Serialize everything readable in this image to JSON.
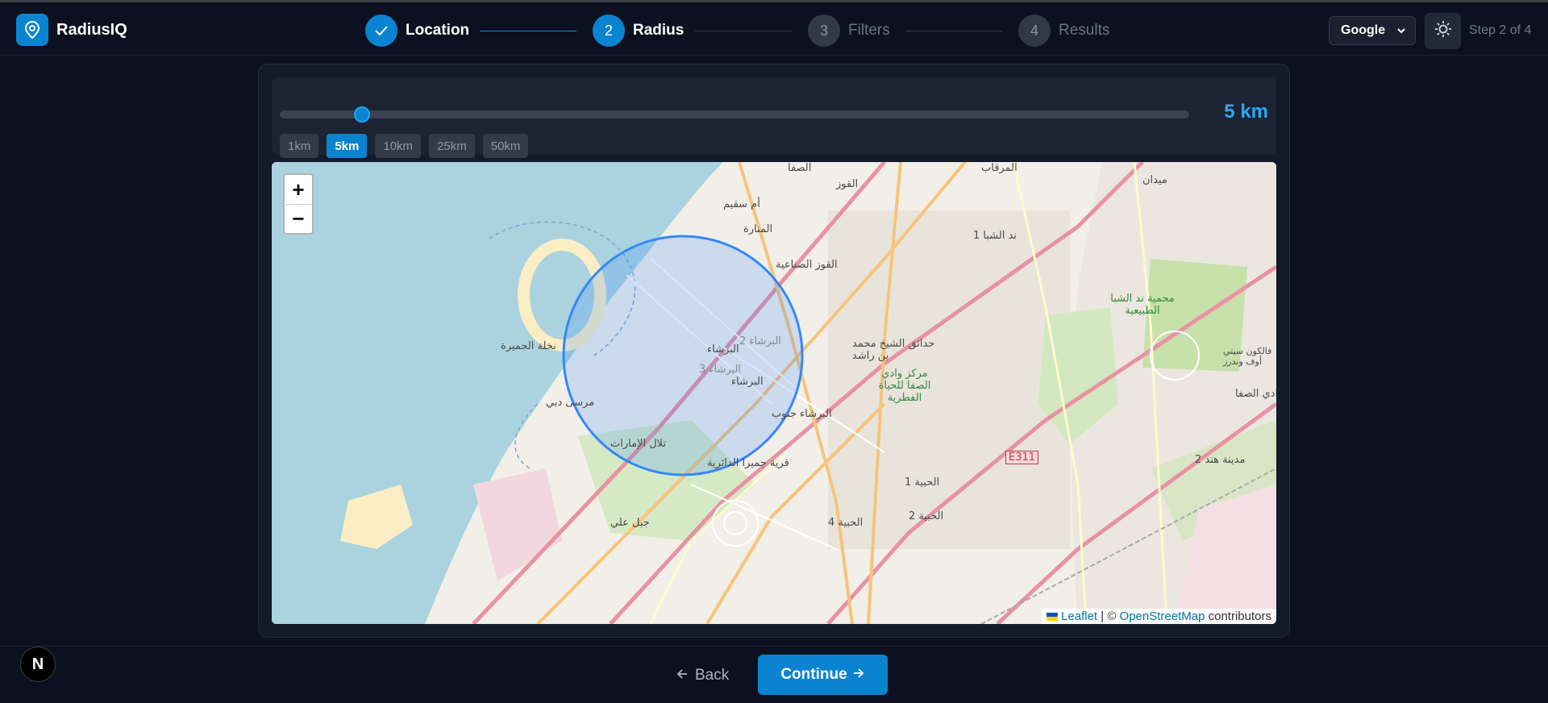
{
  "app": {
    "name": "RadiusIQ"
  },
  "steps": [
    {
      "number": "1",
      "label": "Location",
      "state": "done"
    },
    {
      "number": "2",
      "label": "Radius",
      "state": "active"
    },
    {
      "number": "3",
      "label": "Filters",
      "state": "todo"
    },
    {
      "number": "4",
      "label": "Results",
      "state": "todo"
    }
  ],
  "header": {
    "provider_select": {
      "value": "Google"
    },
    "step_counter": "Step 2 of 4"
  },
  "radius": {
    "value_label": "5 km",
    "slider_fraction": 0.09,
    "presets": [
      "1km",
      "5km",
      "10km",
      "25km",
      "50km"
    ],
    "selected_preset": "5km"
  },
  "map": {
    "zoom_in": "+",
    "zoom_out": "−",
    "attribution": {
      "leaflet": "Leaflet",
      "separator": " | © ",
      "osm": "OpenStreetMap",
      "suffix": " contributors"
    },
    "labels": {
      "palm": "نخلة الجميرة",
      "marsa": "مرسى دبي",
      "barsha": "البرشاء",
      "barsha2": "البرشاء 2",
      "barsha3": "البرشاء 3",
      "barsha_south": "البرشاء جنوب",
      "emirates_hills": "تلال الإمارات",
      "jvc": "قرية جميرا الدائرية",
      "quoz_ind": "القوز الصناعية",
      "quoz": "القوز",
      "um_suqeim": "أم سقيم",
      "manara": "المنارة",
      "safa": "الصفا",
      "gardens": "حدائق الشيخ محمد بن راشد",
      "nad_sheba": "ند الشبا 1",
      "reserve": "محمية ند الشبا الطبيعية",
      "safa_center": "مركز وادي الصفا للحياة الفطرية",
      "hebiah1": "الحبية 1",
      "hebiah2": "الحبية 2",
      "hebiah4": "الحبية 4",
      "jebel_ali": "جبل علي",
      "hind": "مدينة هند 2",
      "wadi_safa": "وادي الصفا",
      "falcon": "فالكون سيتي أوف وندرز",
      "murqab": "المرقاب",
      "maydan": "ميدان",
      "e311": "E311"
    }
  },
  "footer": {
    "back_label": "Back",
    "continue_label": "Continue",
    "badge": "N"
  }
}
